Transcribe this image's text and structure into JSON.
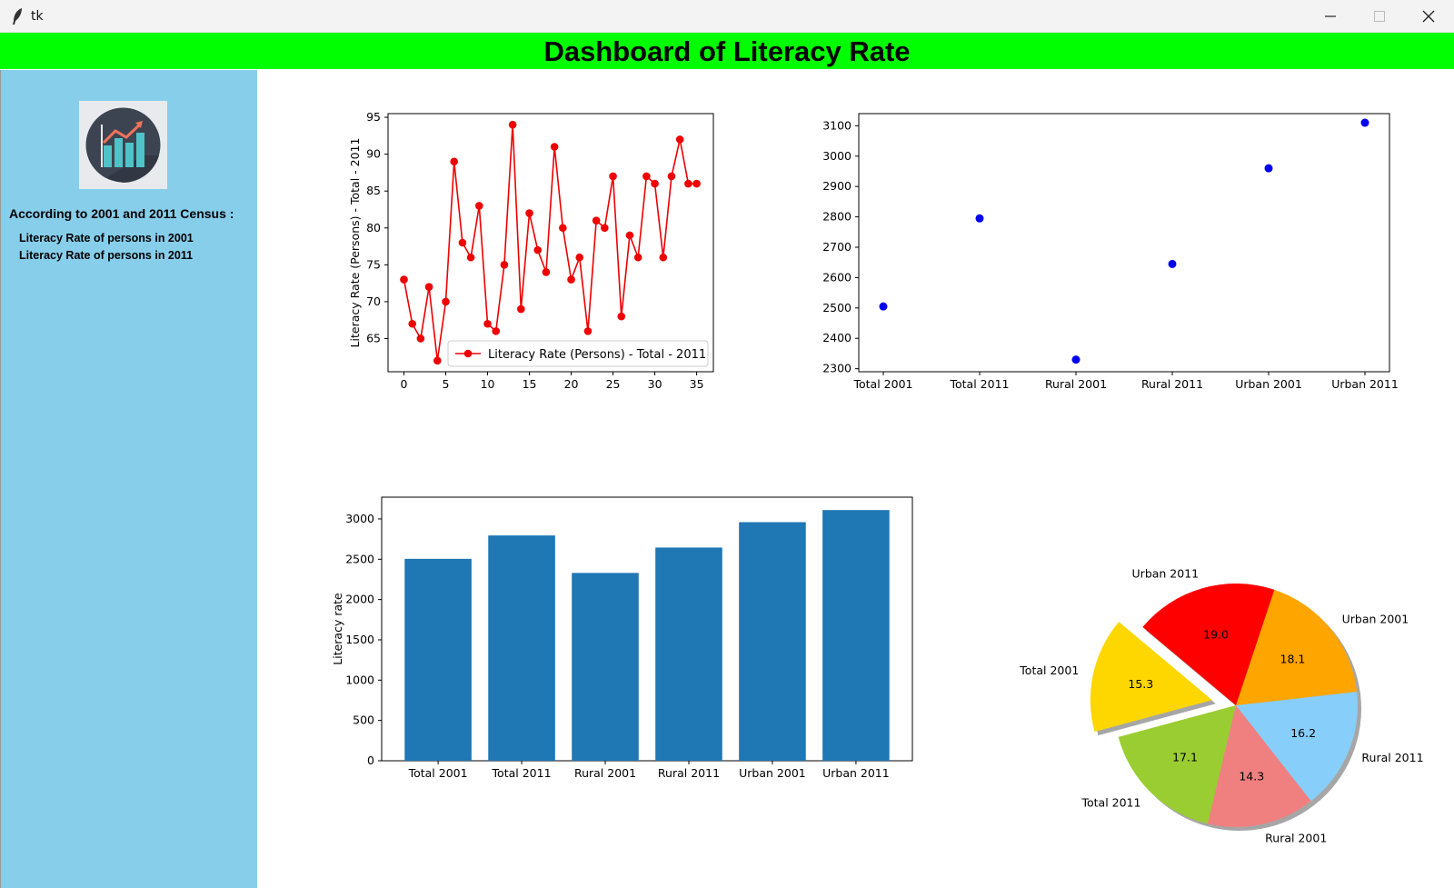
{
  "window": {
    "title": "tk"
  },
  "header": {
    "title": "Dashboard of Literacy Rate"
  },
  "sidebar": {
    "logo_icon": "bar-chart-growth-icon",
    "heading": "According to 2001 and 2011 Census :",
    "items": [
      {
        "label": "Literacy Rate of persons in 2001"
      },
      {
        "label": "Literacy Rate of persons in 2011"
      }
    ]
  },
  "colors": {
    "header_bg": "#00ff00",
    "sidebar_bg": "#87ceeb",
    "line": "#ee0000",
    "scatter": "#0000ee",
    "bar": "#1f77b4"
  },
  "chart_data": [
    {
      "type": "line",
      "ylabel": "Literacy Rate (Persons) - Total - 2011",
      "xlabel": "",
      "xlim": [
        -1.9,
        37.0
      ],
      "ylim": [
        60.5,
        95.5
      ],
      "xticks": [
        0,
        5,
        10,
        15,
        20,
        25,
        30,
        35
      ],
      "yticks": [
        65,
        70,
        75,
        80,
        85,
        90,
        95
      ],
      "legend": "lower right",
      "series": [
        {
          "name": "Literacy Rate (Persons) - Total - 2011",
          "color": "#ee0000",
          "x": [
            0,
            1,
            2,
            3,
            4,
            5,
            6,
            7,
            8,
            9,
            10,
            11,
            12,
            13,
            14,
            15,
            16,
            17,
            18,
            19,
            20,
            21,
            22,
            23,
            24,
            25,
            26,
            27,
            28,
            29,
            30,
            31,
            32,
            33,
            34,
            35
          ],
          "values": [
            73,
            67,
            65,
            72,
            62,
            70,
            89,
            78,
            76,
            83,
            67,
            66,
            75,
            94,
            69,
            82,
            77,
            74,
            91,
            80,
            73,
            76,
            66,
            81,
            80,
            87,
            68,
            79,
            76,
            87,
            86,
            76,
            87,
            92,
            86,
            86
          ]
        }
      ]
    },
    {
      "type": "scatter",
      "categories": [
        "Total 2001",
        "Total 2011",
        "Rural 2001",
        "Rural 2011",
        "Urban 2001",
        "Urban 2011"
      ],
      "values": [
        2505,
        2795,
        2330,
        2645,
        2960,
        3110
      ],
      "ylim": [
        2290,
        3140
      ],
      "yticks": [
        2300,
        2400,
        2500,
        2600,
        2700,
        2800,
        2900,
        3000,
        3100
      ],
      "color": "#0000ee"
    },
    {
      "type": "bar",
      "ylabel": "Literacy rate",
      "categories": [
        "Total 2001",
        "Total 2011",
        "Rural 2001",
        "Rural 2011",
        "Urban 2001",
        "Urban 2011"
      ],
      "values": [
        2505,
        2795,
        2330,
        2645,
        2960,
        3110
      ],
      "ylim": [
        0,
        3270
      ],
      "yticks": [
        0,
        500,
        1000,
        1500,
        2000,
        2500,
        3000
      ],
      "color": "#1f77b4"
    },
    {
      "type": "pie",
      "shadow": true,
      "explode": "Total 2001",
      "slices": [
        {
          "label": "Total 2001",
          "value": 15.3,
          "pct": "15.3",
          "color": "#ffd700"
        },
        {
          "label": "Total 2011",
          "value": 17.1,
          "pct": "17.1",
          "color": "#9acd32"
        },
        {
          "label": "Rural 2001",
          "value": 14.3,
          "pct": "14.3",
          "color": "#f08080"
        },
        {
          "label": "Rural 2011",
          "value": 16.2,
          "pct": "16.2",
          "color": "#87cefa"
        },
        {
          "label": "Urban 2001",
          "value": 18.1,
          "pct": "18.1",
          "color": "#ffa500"
        },
        {
          "label": "Urban 2011",
          "value": 19.0,
          "pct": "19.0",
          "color": "#ff0000"
        }
      ]
    }
  ]
}
